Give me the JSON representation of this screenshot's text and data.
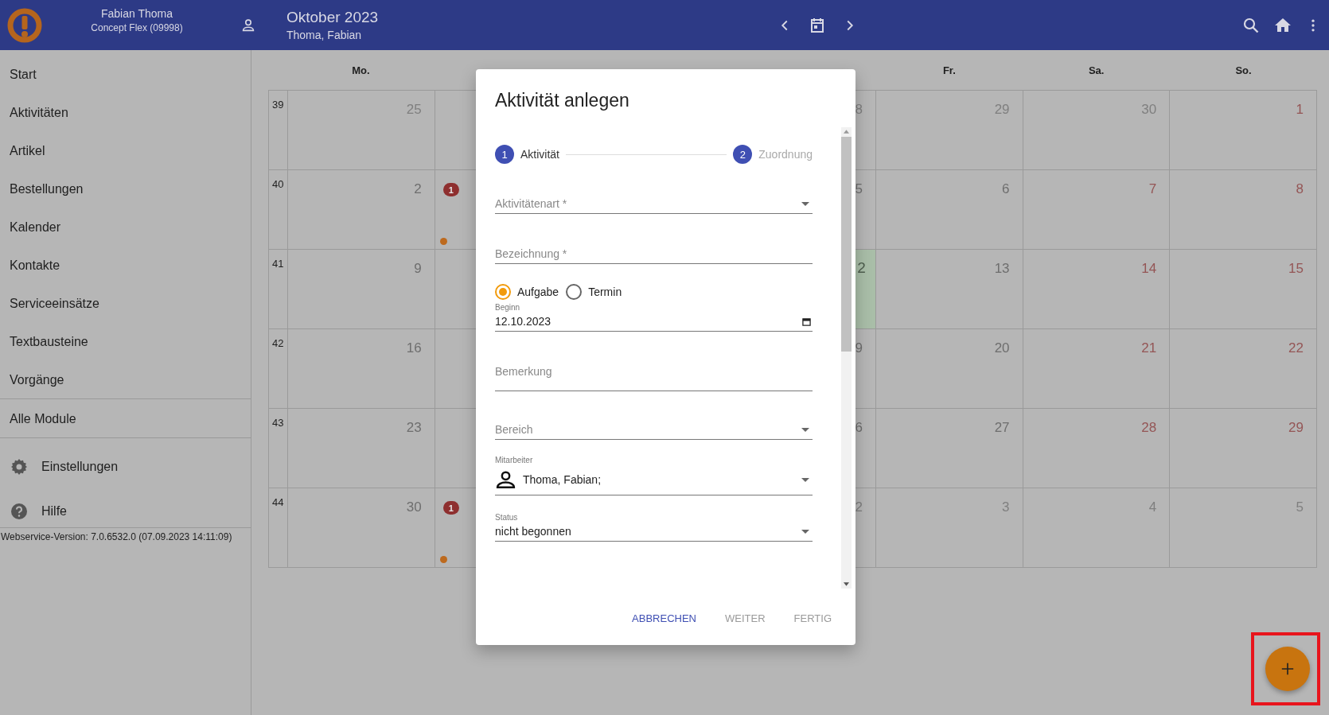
{
  "header": {
    "user_name": "Fabian Thoma",
    "account": "Concept Flex (09998)",
    "title": "Oktober 2023",
    "subtitle": "Thoma, Fabian"
  },
  "sidebar": {
    "items": [
      {
        "label": "Start",
        "kind": "plain"
      },
      {
        "label": "Aktivitäten",
        "kind": "plain"
      },
      {
        "label": "Artikel",
        "kind": "plain"
      },
      {
        "label": "Bestellungen",
        "kind": "plain"
      },
      {
        "label": "Kalender",
        "kind": "plain"
      },
      {
        "label": "Kontakte",
        "kind": "plain"
      },
      {
        "label": "Serviceeinsätze",
        "kind": "plain"
      },
      {
        "label": "Textbausteine",
        "kind": "plain"
      },
      {
        "label": "Vorgänge",
        "kind": "plain"
      },
      {
        "label": "Alle Module",
        "kind": "section"
      },
      {
        "label": "Einstellungen",
        "kind": "settings"
      },
      {
        "label": "Hilfe",
        "kind": "help"
      }
    ],
    "version": "Webservice-Version: 7.0.6532.0 (07.09.2023 14:11:09)"
  },
  "calendar": {
    "weekday_headers": [
      {
        "label": "Mo."
      },
      {
        "label": "Fr."
      },
      {
        "label": "Sa."
      },
      {
        "label": "So."
      }
    ],
    "weeks": [
      {
        "week": "39",
        "days": [
          {
            "number": "25",
            "kind": "muted"
          },
          {
            "dot": false
          },
          {
            "number": "8",
            "kind": "muted",
            "today": false
          },
          {
            "number": "29",
            "kind": "muted"
          },
          {
            "number": "30",
            "kind": "muted"
          },
          {
            "number": "1",
            "kind": "weekend"
          }
        ]
      },
      {
        "week": "40",
        "days": [
          {
            "number": "2",
            "kind": "weekday"
          },
          {
            "badge": "1",
            "dot": true
          },
          {
            "number": "5",
            "kind": "weekday",
            "today": false
          },
          {
            "number": "6",
            "kind": "weekday"
          },
          {
            "number": "7",
            "kind": "weekend"
          },
          {
            "number": "8",
            "kind": "weekend"
          }
        ]
      },
      {
        "week": "41",
        "days": [
          {
            "number": "9",
            "kind": "weekday"
          },
          {
            "dot": false
          },
          {
            "number": "2",
            "kind": "weekday",
            "today": true
          },
          {
            "number": "13",
            "kind": "weekday"
          },
          {
            "number": "14",
            "kind": "weekend"
          },
          {
            "number": "15",
            "kind": "weekend"
          }
        ]
      },
      {
        "week": "42",
        "days": [
          {
            "number": "16",
            "kind": "weekday"
          },
          {
            "dot": false
          },
          {
            "number": "9",
            "kind": "weekday",
            "today": false
          },
          {
            "number": "20",
            "kind": "weekday"
          },
          {
            "number": "21",
            "kind": "weekend"
          },
          {
            "number": "22",
            "kind": "weekend"
          }
        ]
      },
      {
        "week": "43",
        "days": [
          {
            "number": "23",
            "kind": "weekday"
          },
          {
            "dot": false
          },
          {
            "number": "6",
            "kind": "weekday",
            "today": false
          },
          {
            "number": "27",
            "kind": "weekday"
          },
          {
            "number": "28",
            "kind": "weekend"
          },
          {
            "number": "29",
            "kind": "weekend"
          }
        ]
      },
      {
        "week": "44",
        "days": [
          {
            "number": "30",
            "kind": "weekday"
          },
          {
            "badge": "1",
            "dot": true
          },
          {
            "number": "2",
            "kind": "muted",
            "today": false
          },
          {
            "number": "3",
            "kind": "muted"
          },
          {
            "number": "4",
            "kind": "muted"
          },
          {
            "number": "5",
            "kind": "muted"
          }
        ]
      }
    ]
  },
  "dialog": {
    "title": "Aktivität anlegen",
    "steps": [
      {
        "number": "1",
        "label": "Aktivität",
        "selected": true
      },
      {
        "number": "2",
        "label": "Zuordnung",
        "selected": false
      }
    ],
    "fields": [
      {
        "kind": "select",
        "placeholder": "Aktivitätenart *"
      },
      {
        "kind": "text",
        "placeholder": "Bezeichnung *"
      },
      {
        "kind": "radio",
        "options": [
          {
            "label": "Aufgabe",
            "selected": true
          },
          {
            "label": "Termin",
            "selected": false
          }
        ]
      },
      {
        "kind": "date",
        "label": "Beginn",
        "value": "12.10.2023"
      },
      {
        "kind": "textarea",
        "placeholder": "Bemerkung"
      },
      {
        "kind": "select",
        "placeholder": "Bereich"
      },
      {
        "kind": "person",
        "label": "Mitarbeiter",
        "value": "Thoma, Fabian;"
      },
      {
        "kind": "select",
        "label": "Status",
        "value": "nicht begonnen"
      }
    ],
    "buttons": [
      {
        "label": "ABBRECHEN",
        "disabled": false
      },
      {
        "label": "WEITER",
        "disabled": true
      },
      {
        "label": "FERTIG",
        "disabled": true
      }
    ]
  }
}
